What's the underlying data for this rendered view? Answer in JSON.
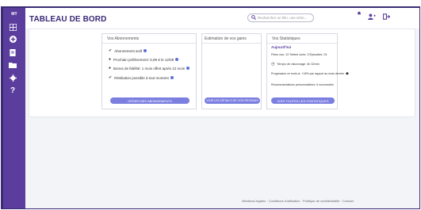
{
  "app": {
    "title": "TABLEAU DE BORD",
    "search_placeholder": "Rechercher un film, une série..."
  },
  "sidebar": {
    "logo": "MY",
    "items": [
      {
        "icon": "grid-icon"
      },
      {
        "icon": "plus-circle-icon"
      },
      {
        "icon": "document-icon"
      },
      {
        "icon": "folder-icon"
      },
      {
        "icon": "settings-icon"
      },
      {
        "icon": "help-icon"
      }
    ]
  },
  "panels": {
    "left": {
      "title": "Vos Abonnements",
      "rows": [
        {
          "text": "Abonnement actif"
        },
        {
          "text": "Prochain prélèvement: 5,99 € le 12/08"
        },
        {
          "text": "Bonus de fidélité: 1 mois offert après 12 mois"
        },
        {
          "text": "Résiliation possible à tout moment"
        }
      ],
      "button": "GÉRER MES ABONNEMENTS"
    },
    "middle": {
      "title": "Estimation de vos gains",
      "button": "VOIR LES DÉTAILS DE VOS REVENUS"
    },
    "right": {
      "title": "Vos Statistiques",
      "rows": [
        {
          "text": "Aujourd'hui"
        },
        {
          "text": "Films vus: 12   Séries vues: 3   Épisodes: 24"
        },
        {
          "text": "Temps de visionnage: 4h 32min"
        },
        {
          "text": "Progression ce mois-ci: +18% par rapport au mois dernier"
        },
        {
          "text": "Recommandations personnalisées: 6 nouveautés"
        }
      ],
      "button": "VOIR TOUTES LES STATISTIQUES"
    }
  },
  "footer": "Mentions légales · Conditions d'utilisation · Politique de confidentialité · Contact"
}
